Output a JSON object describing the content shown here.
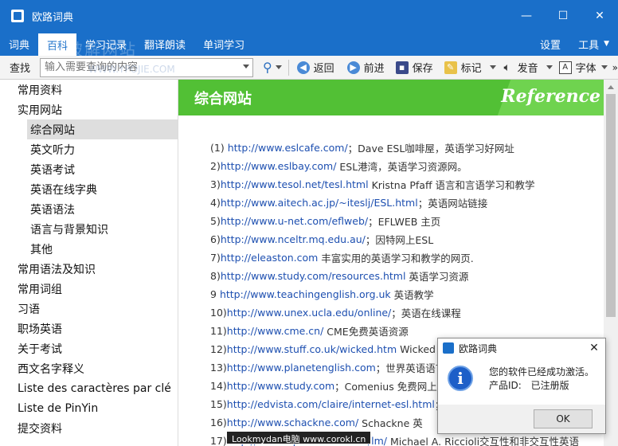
{
  "window": {
    "title": "欧路词典",
    "controls": [
      "—",
      "☐",
      "✕"
    ]
  },
  "menu": {
    "items": [
      "词典",
      "百科",
      "学习记录",
      "翻译朗读",
      "单词学习"
    ],
    "active_index": 1,
    "right": [
      "设置",
      "工具"
    ],
    "watermark": "易破解网站"
  },
  "toolbar": {
    "lookup_label": "查找",
    "search_placeholder": "输入需要查询的内容",
    "watermark": "WWW.YPOJIE.COM",
    "back": "返回",
    "forward": "前进",
    "save": "保存",
    "mark": "标记",
    "speak": "发音",
    "font": "字体"
  },
  "sidebar": {
    "items": [
      {
        "label": "常用资料",
        "level": 0
      },
      {
        "label": "实用网站",
        "level": 0
      },
      {
        "label": "综合网站",
        "level": 1,
        "selected": true
      },
      {
        "label": "英文听力",
        "level": 1
      },
      {
        "label": "英语考试",
        "level": 1
      },
      {
        "label": "英语在线字典",
        "level": 1
      },
      {
        "label": "英语语法",
        "level": 1
      },
      {
        "label": "语言与背景知识",
        "level": 1
      },
      {
        "label": "其他",
        "level": 1
      },
      {
        "label": "常用语法及知识",
        "level": 0
      },
      {
        "label": "常用词组",
        "level": 0
      },
      {
        "label": "习语",
        "level": 0
      },
      {
        "label": "职场英语",
        "level": 0
      },
      {
        "label": "关于考试",
        "level": 0
      },
      {
        "label": "西文名字释义",
        "level": 0
      },
      {
        "label": "Liste des caractères par clé",
        "level": 0
      },
      {
        "label": "Liste de PinYin",
        "level": 0
      },
      {
        "label": "提交资料",
        "level": 0
      }
    ]
  },
  "main": {
    "banner_title": "综合网站",
    "banner_ref": "Reference",
    "lines": [
      {
        "num": "(1) ",
        "url": "http://www.eslcafe.com/",
        "desc": "；Dave ESL咖啡屋，英语学习好网址"
      },
      {
        "num": "2)",
        "url": "http://www.eslbay.com/",
        "desc": " ESL港湾，英语学习资源网。"
      },
      {
        "num": "3)",
        "url": "http://www.tesol.net/tesl.html",
        "desc": " Kristna Pfaff 语言和言语学习和教学"
      },
      {
        "num": "4)",
        "url": "http://www.aitech.ac.jp/~iteslj/ESL.html",
        "desc": "；英语网站链接"
      },
      {
        "num": "5)",
        "url": "http://www.u-net.com/eflweb/",
        "desc": "；EFLWEB 主页"
      },
      {
        "num": "6)",
        "url": "http://www.nceltr.mq.edu.au/",
        "desc": "；因特网上ESL"
      },
      {
        "num": "7)",
        "url": "http://eleaston.com",
        "desc": " 丰富实用的英语学习和教学的网页."
      },
      {
        "num": "8)",
        "url": "http://www.study.com/resources.html",
        "desc": " 英语学习资源"
      },
      {
        "num": "9 ",
        "url": "http://www.teachingenglish.org.uk",
        "desc": " 英语教学"
      },
      {
        "num": "10)",
        "url": "http://www.unex.ucla.edu/online/",
        "desc": "；英语在线课程"
      },
      {
        "num": "11)",
        "url": "http://www.cme.cn/",
        "desc": " CME免费英语资源"
      },
      {
        "num": "12)",
        "url": "http://www.stuff.co.uk/wicked.htm",
        "desc": " Wicked Stuff"
      },
      {
        "num": "13)",
        "url": "http://www.planetenglish.com",
        "desc": "；世界英语语言资"
      },
      {
        "num": "14)",
        "url": "http://www.study.com",
        "desc": "；Comenius 免费网上学校"
      },
      {
        "num": "15)",
        "url": "http://edvista.com/claire/internet-esl.html",
        "desc": "；Clai"
      },
      {
        "num": "16)",
        "url": "http://www.schackne.com/",
        "desc": " Schackne 英"
      },
      {
        "num": "17)",
        "url": "http://www.lapasserelle.com/lm/",
        "desc": " Michael A. Riccioli交互性和非交互性英语"
      }
    ]
  },
  "dialog": {
    "title": "欧路词典",
    "message": "您的软件已经成功激活。",
    "product_label": "产品ID:",
    "product_value": "已注册版",
    "ok": "OK",
    "watermark": "易破解网站",
    "watermark_url": "WWW.YPOJIE.COM"
  },
  "footer_watermark": "Lookmydan电脑 www.corokl.cn",
  "colors": {
    "titlebar": "#1a6fc9",
    "banner": "#52c035",
    "link": "#1d4fb0"
  }
}
